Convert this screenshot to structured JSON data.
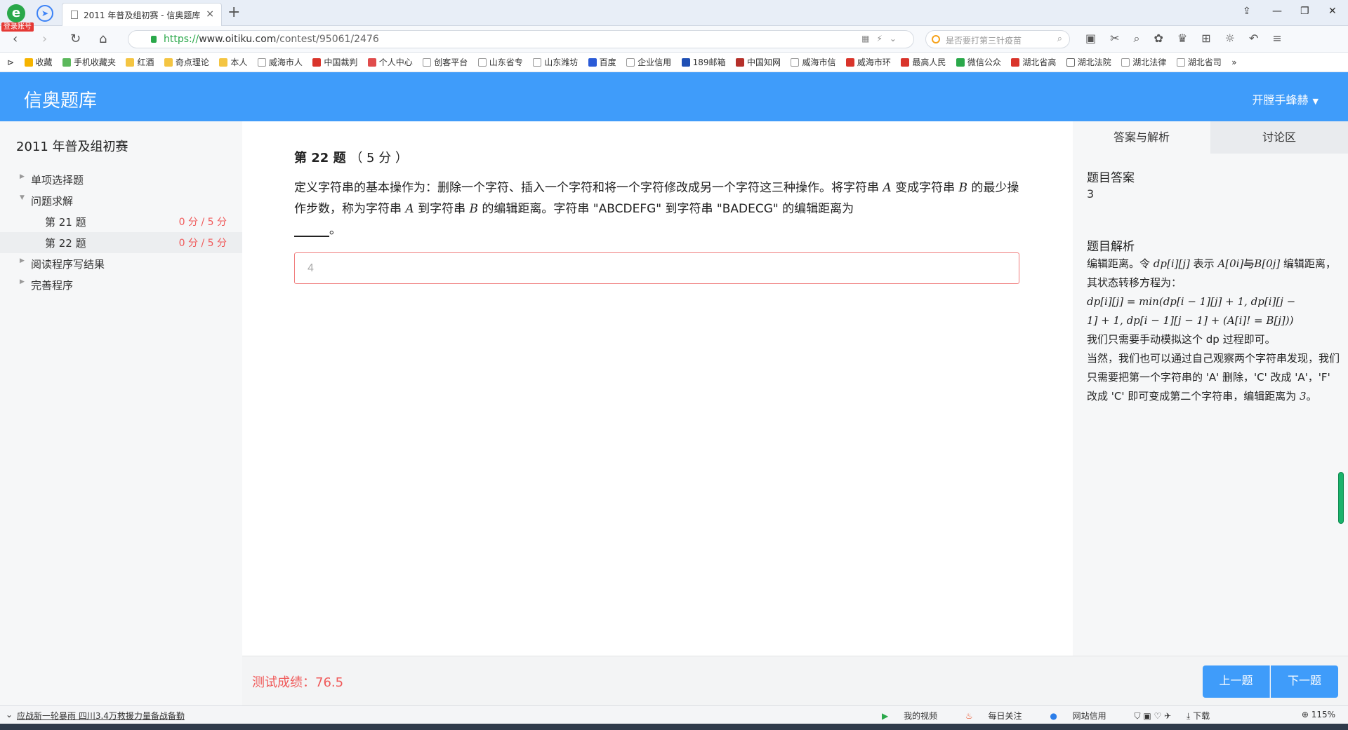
{
  "browser": {
    "login_badge": "登录账号",
    "tab_title": "2011 年普及组初赛 - 信奥题库",
    "tab_close": "×",
    "new_tab": "+",
    "url_scheme": "https://",
    "url_host": "www.oitiku.com",
    "url_path": "/contest/95061/2476",
    "search_placeholder": "是否要打第三针疫苗",
    "bookmarks": [
      "收藏",
      "手机收藏夹",
      "红酒",
      "奇点理论",
      "本人",
      "威海市人",
      "中国裁判",
      "个人中心",
      "创客平台",
      "山东省专",
      "山东潍坊",
      "百度",
      "企业信用",
      "189邮箱",
      "中国知网",
      "威海市信",
      "威海市环",
      "最高人民",
      "微信公众",
      "湖北省高",
      "湖北法院",
      "湖北法律",
      "湖北省司",
      "»"
    ]
  },
  "site": {
    "title": "信奥题库",
    "user": "开膛手蜂赫"
  },
  "sidebar": {
    "contest_title": "2011 年普及组初赛",
    "sections": {
      "single_choice": "单项选择题",
      "problem_solving": "问题求解",
      "reading": "阅读程序写结果",
      "complete": "完善程序"
    },
    "children": [
      {
        "label": "第 21 题",
        "score": "0 分 / 5 分"
      },
      {
        "label": "第 22 题",
        "score": "0 分 / 5 分"
      }
    ]
  },
  "question": {
    "number_label": "第 22 题",
    "points": "（ 5 分 ）",
    "text_1": "定义字符串的基本操作为：删除一个字符、插入一个字符和将一个字符修改成另一个字符这三种操作。将字符串 ",
    "var_a": "A",
    "text_2": " 变成字符串 ",
    "var_b": "B",
    "text_3": " 的最少操作步数，称为字符串 ",
    "text_4": " 到字符串 ",
    "text_5": " 的编辑距离。字符串 \"ABCDEFG\" 到字符串 \"BADECG\" 的编辑距离为",
    "text_end": "。",
    "answer_value": "4"
  },
  "right_panel": {
    "tab_answer": "答案与解析",
    "tab_discussion": "讨论区",
    "answer_title": "题目答案",
    "answer_value": "3",
    "analysis_title": "题目解析",
    "analysis_p1_a": "编辑距离。令 ",
    "analysis_p1_b": "dp[i][j]",
    "analysis_p1_c": " 表示 ",
    "analysis_p1_d": "A[0i]",
    "analysis_p1_e": "与",
    "analysis_p1_f": "B[0j]",
    "analysis_p1_g": " 编辑距离，其状态转移方程为：",
    "analysis_formula_1": "dp[i][j] = min(dp[i − 1][j] + 1, dp[i][j −",
    "analysis_formula_2": "1] + 1, dp[i − 1][j − 1] + (A[i]! = B[j]))",
    "analysis_p2": "我们只需要手动模拟这个 dp 过程即可。",
    "analysis_p3": "当然，我们也可以通过自己观察两个字符串发现，我们只需要把第一个字符串的 'A' 删除，'C' 改成 'A'，'F' 改成 'C' 即可变成第二个字符串，编辑距离为 ",
    "analysis_p3_num": "3",
    "analysis_p3_end": "。"
  },
  "bottom": {
    "score_text": "测试成绩：76.5",
    "prev": "上一题",
    "next": "下一题"
  },
  "statusbar": {
    "news": "应战新一轮暴雨 四川3.4万救援力量备战备勤",
    "my_video": "我的视频",
    "daily": "每日关注",
    "site_trust": "网站信用",
    "download": "下载",
    "zoom": "115%"
  }
}
